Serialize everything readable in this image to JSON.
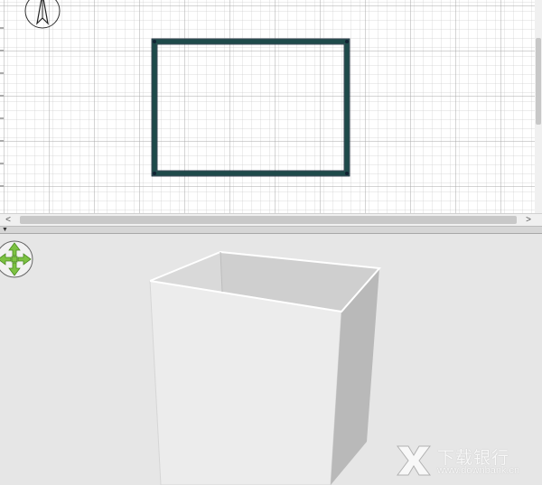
{
  "plan": {
    "compass_icon": "north-arrow-icon",
    "grid_color": "#c9c9c9",
    "major_grid_color": "#a9a9a9",
    "wall_color": "#1e4a4a"
  },
  "scrollbar": {
    "left_arrow": "<",
    "right_arrow": ">"
  },
  "view3d": {
    "navigator_icon": "navigation-arrows-icon",
    "navigator_color": "#7cc242",
    "box_color": "#e8e8e8"
  },
  "watermark": {
    "title": "下载银行",
    "url": "www.downbank.cn"
  }
}
